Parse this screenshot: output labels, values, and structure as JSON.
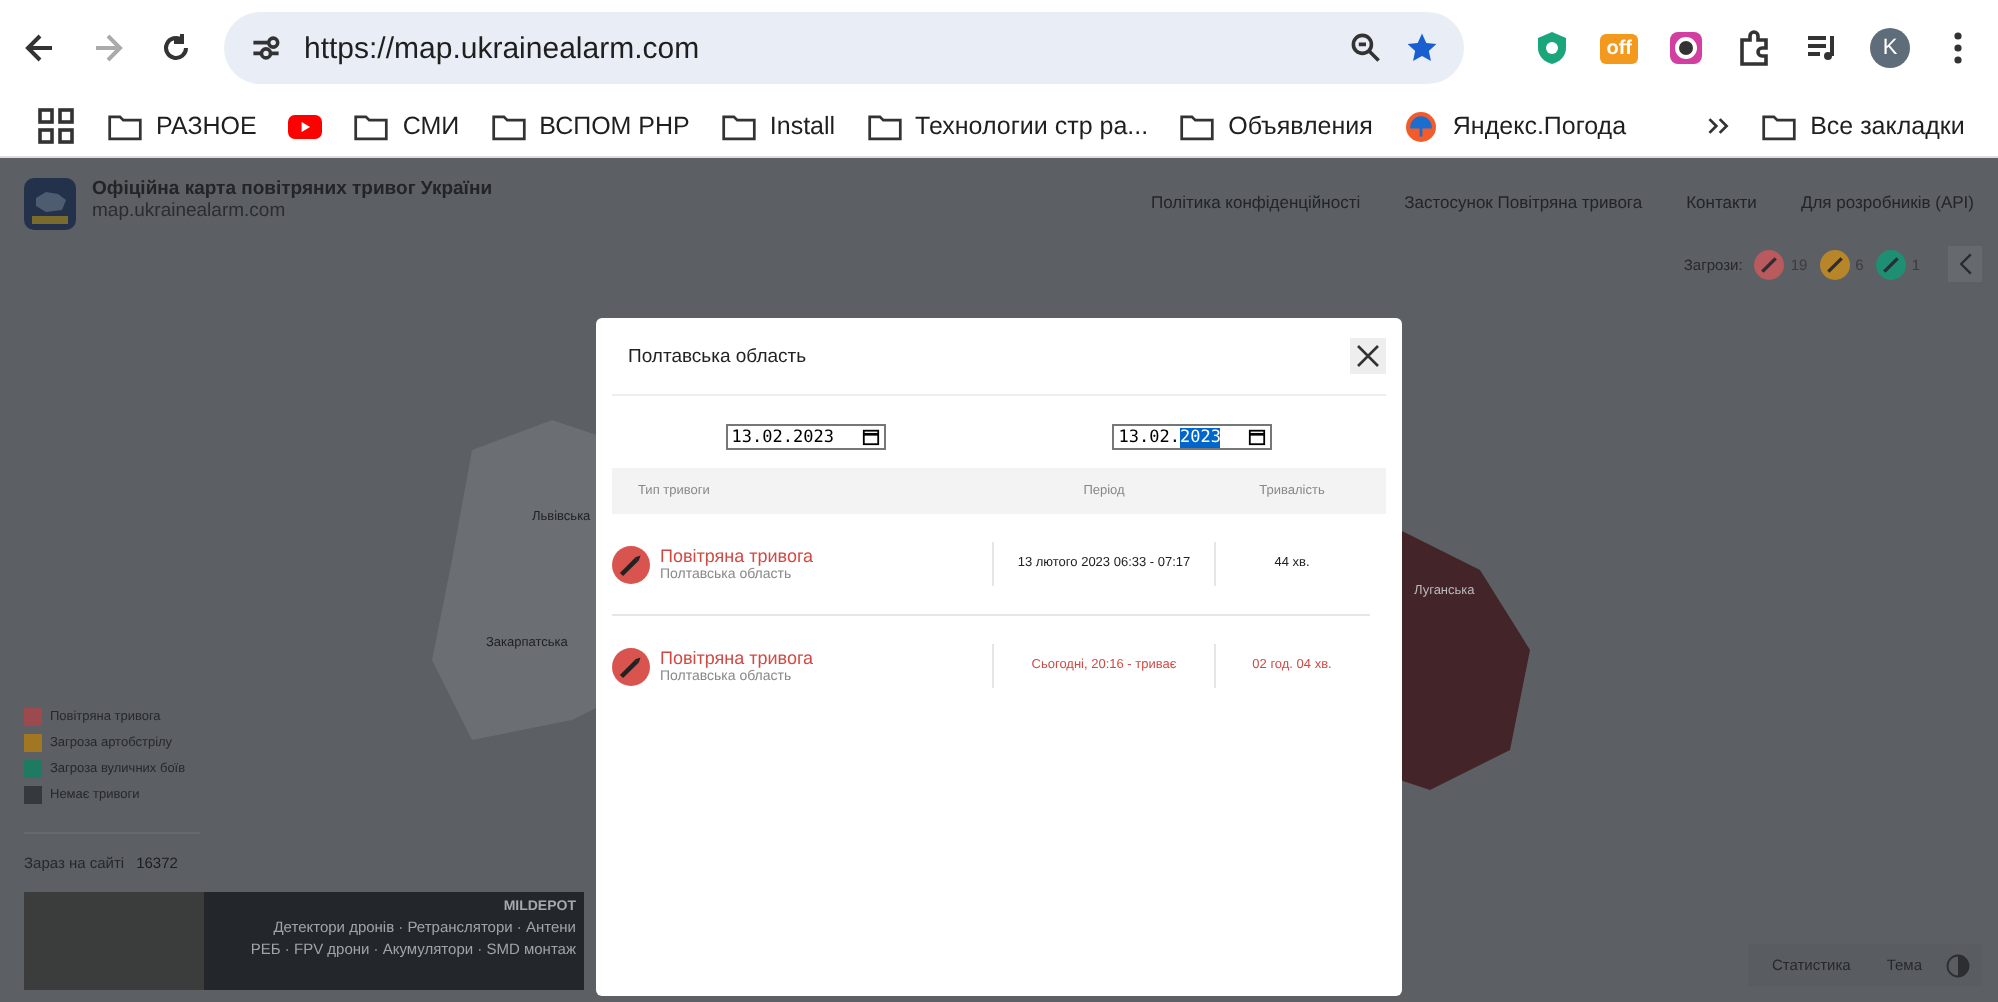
{
  "browser": {
    "url": "https://map.ukrainealarm.com",
    "profile_initial": "K",
    "extension_badge": "off"
  },
  "bookmarks": [
    {
      "label": "РАЗНОЕ",
      "kind": "folder"
    },
    {
      "kind": "video"
    },
    {
      "label": "СМИ",
      "kind": "folder"
    },
    {
      "label": "ВСПОМ РНР",
      "kind": "folder"
    },
    {
      "label": "Install",
      "kind": "folder"
    },
    {
      "label": "Технологии стр ра...",
      "kind": "folder"
    },
    {
      "label": "Объявления",
      "kind": "folder"
    },
    {
      "label": "Яндекс.Погода",
      "kind": "weather"
    }
  ],
  "all_bookmarks": "Все закладки",
  "site": {
    "title": "Офіційна карта повітряних тривог України",
    "domain": "map.ukrainealarm.com"
  },
  "nav": [
    "Політика конфіденційності",
    "Застосунок Повітряна тривога",
    "Контакти",
    "Для розробників (API)"
  ],
  "threats": {
    "label": "Загрози:",
    "items": [
      {
        "count": "19",
        "color": "#b85a5e"
      },
      {
        "count": "6",
        "color": "#b8862a"
      },
      {
        "count": "1",
        "color": "#1f8f73"
      }
    ]
  },
  "map_labels": [
    {
      "text": "Львівська",
      "kind": "light"
    },
    {
      "text": "Закарпатська",
      "kind": "light"
    },
    {
      "text": "Луганська",
      "kind": "alert"
    }
  ],
  "legend": [
    {
      "label": "Повітряна тривога",
      "color": "#9c4a4e"
    },
    {
      "label": "Загроза артобстрілу",
      "color": "#a17722"
    },
    {
      "label": "Загроза вуличних боїв",
      "color": "#1f7a63"
    },
    {
      "label": "Немає тривоги",
      "color": "#35383d"
    }
  ],
  "online": {
    "label": "Зараз на сайті",
    "count": "16372"
  },
  "banner": {
    "brand": "MILDEPOT",
    "line_1": "Детектори дронів · Ретранслятори · Антени",
    "line_2": "РЕБ · FPV дрони · Акумулятори · SMD монтаж"
  },
  "bottom_buttons": [
    "Статистика",
    "Тема"
  ],
  "modal": {
    "title": "Полтавська область",
    "date_from": {
      "value": "13.02.2023",
      "year_selected": false
    },
    "date_to": {
      "value": "13.02.2023",
      "year_selected": true
    },
    "columns": [
      "Тип тривоги",
      "Період",
      "Тривалість"
    ],
    "rows": [
      {
        "type": "Повітряна тривога",
        "region": "Полтавська область",
        "period": "13 лютого 2023 06:33 - 07:17",
        "duration": "44 хв.",
        "ongoing": false
      },
      {
        "type": "Повітряна тривога",
        "region": "Полтавська область",
        "period": "Сьогодні, 20:16 - триває",
        "duration": "02 год. 04 хв.",
        "ongoing": true
      }
    ]
  }
}
